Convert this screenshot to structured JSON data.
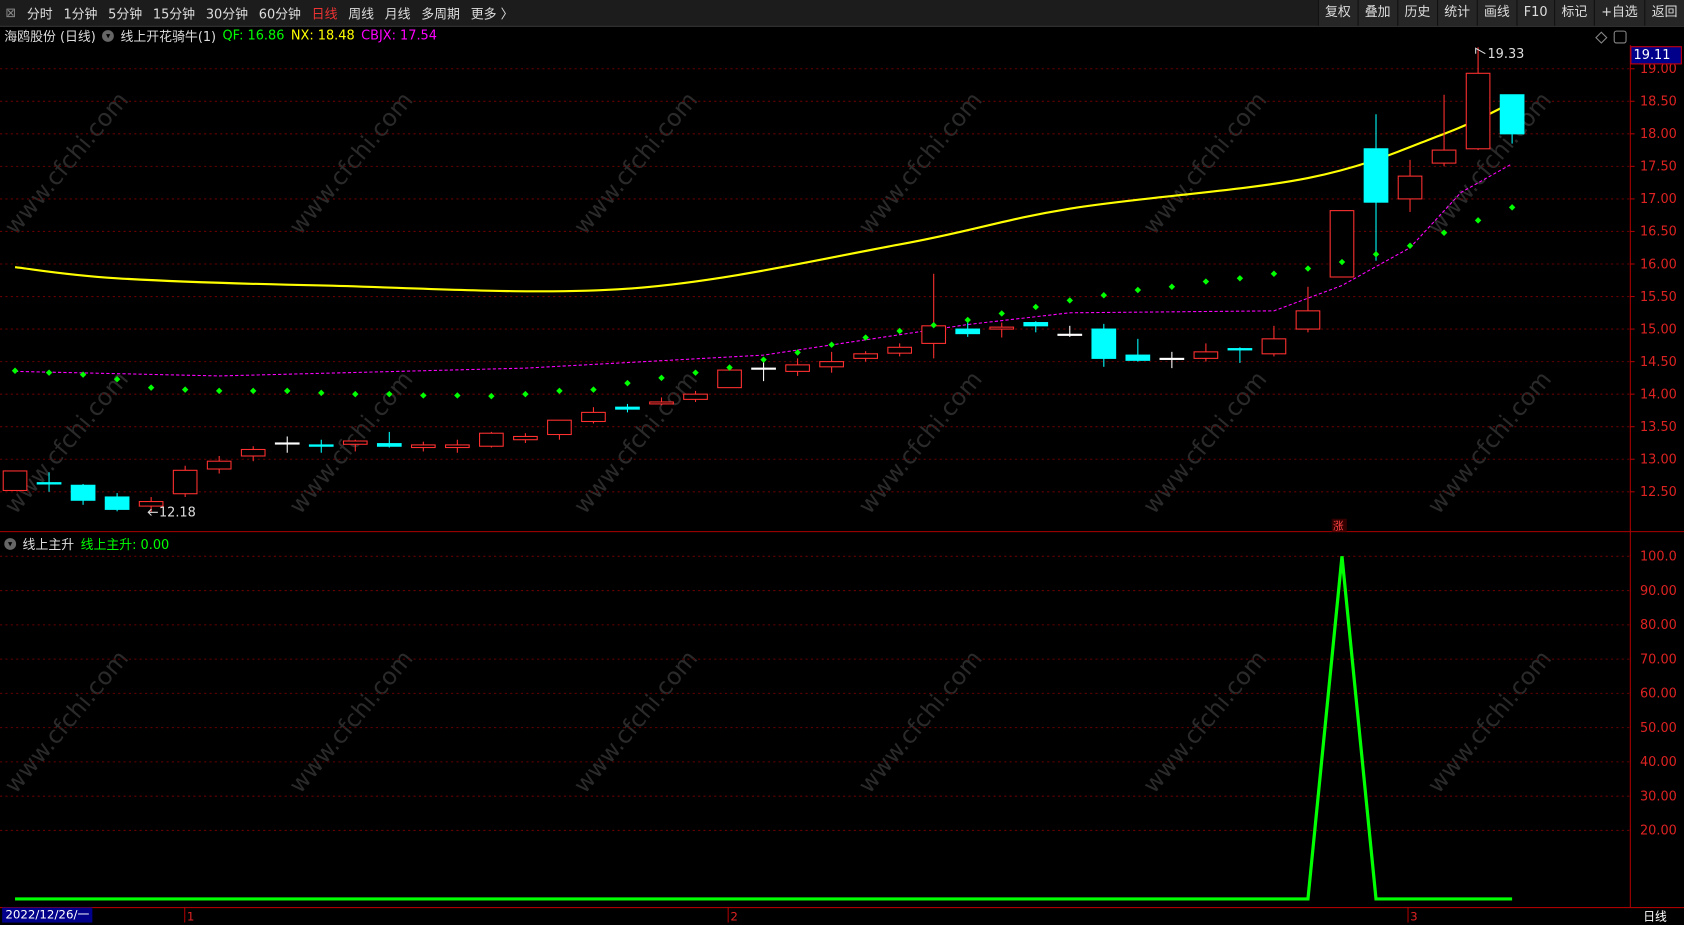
{
  "toolbar": {
    "periods": [
      "分时",
      "1分钟",
      "5分钟",
      "15分钟",
      "30分钟",
      "60分钟",
      "日线",
      "周线",
      "月线",
      "多周期",
      "更多 〉"
    ],
    "active": "日线",
    "buttons": [
      "复权",
      "叠加",
      "历史",
      "统计",
      "画线",
      "F10",
      "标记",
      "+自选",
      "返回"
    ]
  },
  "main": {
    "stock": "海鸥股份 (日线)",
    "indicator": "线上开花骑牛(1)",
    "qf_label": "QF: 16.86",
    "nx_label": "NX: 18.48",
    "cbjx_label": "CBJX: 17.54",
    "current_price": "19.11",
    "high_label": "19.33",
    "low_label": "12.18",
    "zhang_mark": "涨",
    "colors": {
      "up": "#ff3030",
      "down": "#00ffff",
      "qf": "#00ff00",
      "nx": "#ffff00",
      "cbjx": "#ff00ff"
    }
  },
  "sub": {
    "title": "线上主升",
    "value_label": "线上主升: 0.00",
    "axis": [
      "100.0",
      "90.00",
      "80.00",
      "70.00",
      "60.00",
      "50.00",
      "40.00",
      "30.00",
      "20.00"
    ]
  },
  "axis": {
    "prices": [
      "19.00",
      "18.50",
      "18.00",
      "17.50",
      "17.00",
      "16.50",
      "16.00",
      "15.50",
      "15.00",
      "14.50",
      "14.00",
      "13.50",
      "13.00",
      "12.50"
    ],
    "date": "2022/12/26/一",
    "months": [
      "1",
      "2",
      "3"
    ],
    "period": "日线"
  },
  "watermark": "www.cfchi.com",
  "chart_data": {
    "type": "candlestick",
    "ohlc": [
      [
        12.52,
        12.82,
        12.52,
        12.82
      ],
      [
        12.64,
        12.8,
        12.5,
        12.62
      ],
      [
        12.6,
        12.62,
        12.3,
        12.37
      ],
      [
        12.42,
        12.48,
        12.2,
        12.23
      ],
      [
        12.28,
        12.42,
        12.18,
        12.35
      ],
      [
        12.47,
        12.9,
        12.42,
        12.83
      ],
      [
        12.85,
        13.05,
        12.78,
        12.97
      ],
      [
        13.05,
        13.2,
        12.97,
        13.15
      ],
      [
        13.25,
        13.35,
        13.1,
        13.25
      ],
      [
        13.22,
        13.3,
        13.1,
        13.2
      ],
      [
        13.23,
        13.3,
        13.12,
        13.28
      ],
      [
        13.24,
        13.42,
        13.18,
        13.2
      ],
      [
        13.18,
        13.27,
        13.12,
        13.22
      ],
      [
        13.18,
        13.3,
        13.1,
        13.22
      ],
      [
        13.2,
        13.42,
        13.18,
        13.4
      ],
      [
        13.3,
        13.4,
        13.25,
        13.35
      ],
      [
        13.38,
        13.6,
        13.3,
        13.6
      ],
      [
        13.58,
        13.8,
        13.55,
        13.72
      ],
      [
        13.8,
        13.85,
        13.72,
        13.77
      ],
      [
        13.85,
        13.95,
        13.83,
        13.88
      ],
      [
        13.92,
        14.05,
        13.88,
        14.0
      ],
      [
        14.1,
        14.4,
        14.1,
        14.37
      ],
      [
        14.4,
        14.55,
        14.2,
        14.4
      ],
      [
        14.35,
        14.55,
        14.28,
        14.45
      ],
      [
        14.42,
        14.65,
        14.33,
        14.5
      ],
      [
        14.55,
        14.66,
        14.5,
        14.62
      ],
      [
        14.63,
        14.78,
        14.58,
        14.72
      ],
      [
        14.78,
        15.85,
        14.55,
        15.05
      ],
      [
        15.0,
        15.1,
        14.88,
        14.93
      ],
      [
        15.0,
        15.1,
        14.87,
        15.03
      ],
      [
        15.1,
        15.12,
        14.95,
        15.05
      ],
      [
        14.92,
        15.05,
        14.88,
        14.92
      ],
      [
        15.0,
        15.08,
        14.42,
        14.55
      ],
      [
        14.6,
        14.85,
        14.5,
        14.52
      ],
      [
        14.55,
        14.65,
        14.4,
        14.55
      ],
      [
        14.55,
        14.78,
        14.5,
        14.65
      ],
      [
        14.7,
        14.72,
        14.48,
        14.68
      ],
      [
        14.62,
        15.05,
        14.58,
        14.85
      ],
      [
        15.0,
        15.65,
        14.95,
        15.28
      ],
      [
        15.8,
        16.82,
        15.8,
        16.82
      ],
      [
        17.77,
        18.3,
        16.05,
        16.95
      ],
      [
        17.0,
        17.6,
        16.8,
        17.35
      ],
      [
        17.55,
        18.6,
        17.5,
        17.75
      ],
      [
        17.77,
        19.33,
        17.75,
        18.93
      ],
      [
        18.6,
        18.6,
        17.85,
        18.0
      ]
    ],
    "qf": [
      14.36,
      14.33,
      14.3,
      14.23,
      14.1,
      14.07,
      14.05,
      14.05,
      14.05,
      14.02,
      14.0,
      14.0,
      13.98,
      13.98,
      13.97,
      14.0,
      14.05,
      14.07,
      14.17,
      14.25,
      14.33,
      14.41,
      14.53,
      14.64,
      14.76,
      14.87,
      14.97,
      15.06,
      15.14,
      15.24,
      15.34,
      15.44,
      15.52,
      15.6,
      15.65,
      15.73,
      15.78,
      15.85,
      15.93,
      16.03,
      16.15,
      16.28,
      16.48,
      16.67,
      16.87
    ],
    "nx_points": [
      [
        0,
        15.95
      ],
      [
        3,
        15.78
      ],
      [
        9,
        15.67
      ],
      [
        18,
        15.62
      ],
      [
        26,
        16.3
      ],
      [
        31,
        16.85
      ],
      [
        38,
        17.32
      ],
      [
        42,
        18.0
      ],
      [
        44,
        18.48
      ]
    ],
    "cbjx_points": [
      [
        0,
        14.35
      ],
      [
        6,
        14.28
      ],
      [
        15,
        14.4
      ],
      [
        22,
        14.6
      ],
      [
        28,
        15.07
      ],
      [
        31,
        15.25
      ],
      [
        37,
        15.28
      ],
      [
        39,
        15.67
      ],
      [
        41,
        16.25
      ],
      [
        42.5,
        17.1
      ],
      [
        44,
        17.54
      ]
    ],
    "sub_values": [
      0,
      0,
      0,
      0,
      0,
      0,
      0,
      0,
      0,
      0,
      0,
      0,
      0,
      0,
      0,
      0,
      0,
      0,
      0,
      0,
      0,
      0,
      0,
      0,
      0,
      0,
      0,
      0,
      0,
      0,
      0,
      0,
      0,
      0,
      0,
      0,
      0,
      0,
      0,
      100,
      0,
      0,
      0,
      0,
      0
    ],
    "price_range": [
      12.0,
      19.5
    ],
    "sub_range": [
      0,
      100
    ]
  }
}
